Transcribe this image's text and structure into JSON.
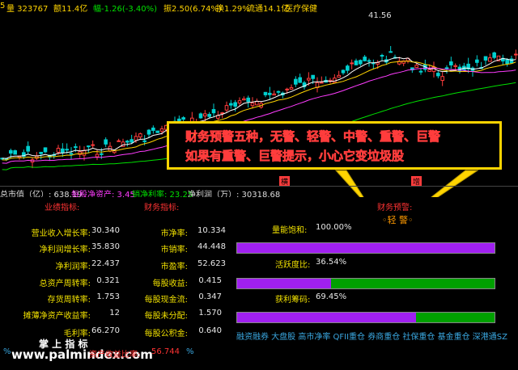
{
  "top": {
    "volume_label": "量 323767",
    "amount_label": "额11.4亿",
    "change_label": "幅-1.26(-3.40%)",
    "amplitude_label": "振2.50(6.74%)",
    "turnover_label": "换1.29%",
    "float_label": "流通14.1亿",
    "sector_label": "医疗保健",
    "left_fragment": "5"
  },
  "chart": {
    "peak_label": "41.56",
    "callout_line1": "财务预警五种，无警、轻警、中警、重警、巨警",
    "callout_line2": "如果有重警、巨警提示，小心它变垃圾股",
    "tag_left": "横",
    "tag_right": "增"
  },
  "midbar": {
    "mktcap": "总市值（亿）: 638.19",
    "eps_net": "每股净资产: 3.45",
    "net_margin": "销净利率: 23.25",
    "net_profit": "净利润（万）: 30318.68"
  },
  "panel": {
    "growth_header": "业绩指标:",
    "finance_header": "财务指标:",
    "warning_header": "财务预警:",
    "warning_value": "◦轻 警◦",
    "growth_rows": [
      {
        "label": "营业收入增长率:",
        "value": "30.340"
      },
      {
        "label": "净利润增长率:",
        "value": "35.830"
      },
      {
        "label": "净利润率:",
        "value": "22.437"
      },
      {
        "label": "总资产周转率:",
        "value": "0.321"
      },
      {
        "label": "存货周转率:",
        "value": "1.753"
      },
      {
        "label": "摊薄净资产收益率:",
        "value": "12"
      },
      {
        "label": "毛利率:",
        "value": "66.270"
      }
    ],
    "finance_rows": [
      {
        "label": "市净率:",
        "value": "10.334"
      },
      {
        "label": "市销率:",
        "value": "44.448"
      },
      {
        "label": "市盈率:",
        "value": "52.623"
      },
      {
        "label": "每股收益:",
        "value": "0.415"
      },
      {
        "label": "每股现金流:",
        "value": "0.347"
      },
      {
        "label": "每股未分配:",
        "value": "1.570"
      },
      {
        "label": "每股公积金:",
        "value": "0.640"
      }
    ],
    "bars": [
      {
        "label": "量能饱和:",
        "value_text": "100.00%",
        "fill": 1.0
      },
      {
        "label": "活跃度比:",
        "value_text": "36.54%",
        "fill": 0.3654
      },
      {
        "label": "获利筹码:",
        "value_text": "69.45%",
        "fill": 0.6945
      }
    ],
    "tags": "融资融券 大盘股 高市净率 QFII重仓 券商重仓 社保重仓 基金重仓 深港通SZ",
    "watermark_title": "掌 上 指 标",
    "watermark_url": "www.palmindex.com",
    "bottom_label": "资产收益比率:",
    "bottom_value": "56.744",
    "bottom_unit": "%",
    "bottom_unit_left": "%"
  }
}
